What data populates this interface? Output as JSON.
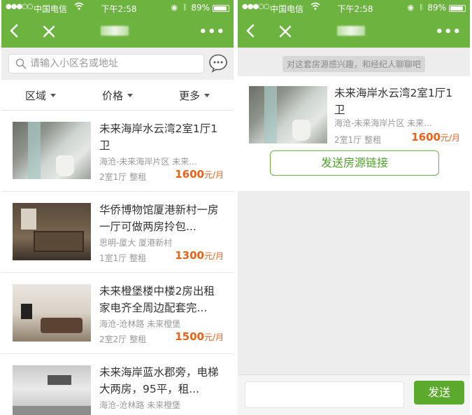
{
  "status": {
    "carrier": "中国电信",
    "time": "下午2:58",
    "battery": "89%",
    "battery_level": 0.89
  },
  "left": {
    "search": {
      "placeholder": "请输入小区名或地址"
    },
    "filters": [
      "区域",
      "价格",
      "更多"
    ],
    "listings": [
      {
        "title": "未来海岸水云湾2室1厅1卫",
        "location": "海沧-未来海岸片区 未来...",
        "spec": "2室1厅 整租",
        "price": "1600",
        "unit": "元/月"
      },
      {
        "title": "华侨博物馆厦港新村一房一厅可做两房拎包...",
        "location": "思明-厦大 厦港新村",
        "spec": "1室1厅 整租",
        "price": "1300",
        "unit": "元/月"
      },
      {
        "title": "未来橙堡楼中楼2房出租家电齐全周边配套完...",
        "location": "海沧-沧林路 未来橙堡",
        "spec": "2室2厅 整租",
        "price": "1500",
        "unit": "元/月"
      },
      {
        "title": "未来海岸蓝水郡旁，电梯大两房，95平，租...",
        "location": "海沧-沧林路 未来橙堡",
        "spec": "",
        "price": "",
        "unit": ""
      }
    ]
  },
  "right": {
    "prompt": "对这套房源感兴趣，和经纪人聊聊吧",
    "card": {
      "title": "未来海岸水云湾2室1厅1卫",
      "location": "海沧-未来海岸片区 未来...",
      "spec": "2室1厅 整租",
      "price": "1600",
      "unit": "元/月"
    },
    "send_link_label": "发送房源链接",
    "send_label": "发送"
  },
  "colors": {
    "brand": "#6cb33f",
    "price": "#e8631c"
  },
  "icons": [
    "back-icon",
    "close-icon",
    "more-icon",
    "search-icon",
    "chat-bubble-icon",
    "wifi-icon",
    "bluetooth-icon",
    "lock-rotation-icon",
    "battery-icon"
  ]
}
